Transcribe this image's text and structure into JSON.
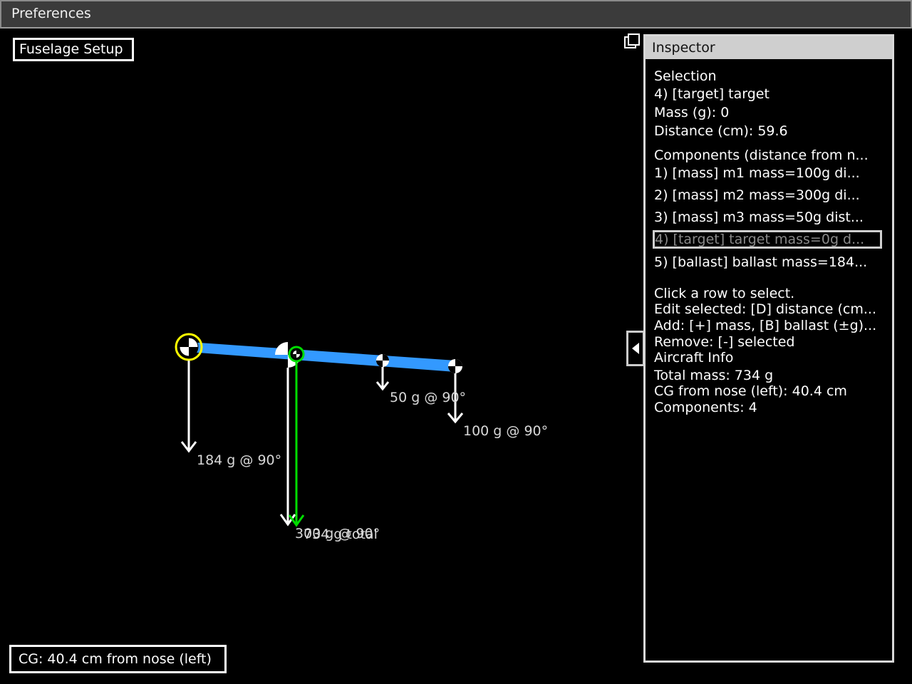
{
  "window": {
    "title": "Preferences"
  },
  "setup_button": "Fuselage Setup",
  "cg_status": "CG: 40.4 cm from nose (left)",
  "inspector": {
    "title": "Inspector",
    "selection": {
      "heading": "Selection",
      "item": "4) [target] target",
      "mass": "Mass (g): 0",
      "distance": "Distance (cm): 59.6"
    },
    "components_heading": "Components (distance from n...",
    "rows": [
      "1) [mass] m1  mass=100g  di...",
      "2) [mass] m2  mass=300g  di...",
      "3) [mass] m3  mass=50g  dist...",
      "4) [target] target  mass=0g  d...",
      "5) [ballast] ballast  mass=184..."
    ],
    "help": [
      "Click a row to select.",
      "Edit selected: [D] distance (cm...",
      "Add: [+] mass, [B] ballast (±g)...",
      "Remove: [-] selected"
    ],
    "aircraft": {
      "heading": "Aircraft Info",
      "total_mass": "Total mass: 734 g",
      "cg": "CG from nose (left): 40.4 cm",
      "components": "Components: 4"
    }
  },
  "canvas": {
    "labels": {
      "ballast": "184 g @ 90°",
      "m2": "300 g @ 90°",
      "total": "734 g total",
      "m3": "50 g @ 90°",
      "m1": "100 g @ 90°"
    }
  },
  "colors": {
    "fuselage": "#3399ff",
    "target_ring": "#ffff00",
    "cg_arrow": "#00dd00",
    "arrow": "#ffffff"
  },
  "icons": [
    "float-window-icon",
    "collapse-panel-icon",
    "cg-marker-icon"
  ]
}
